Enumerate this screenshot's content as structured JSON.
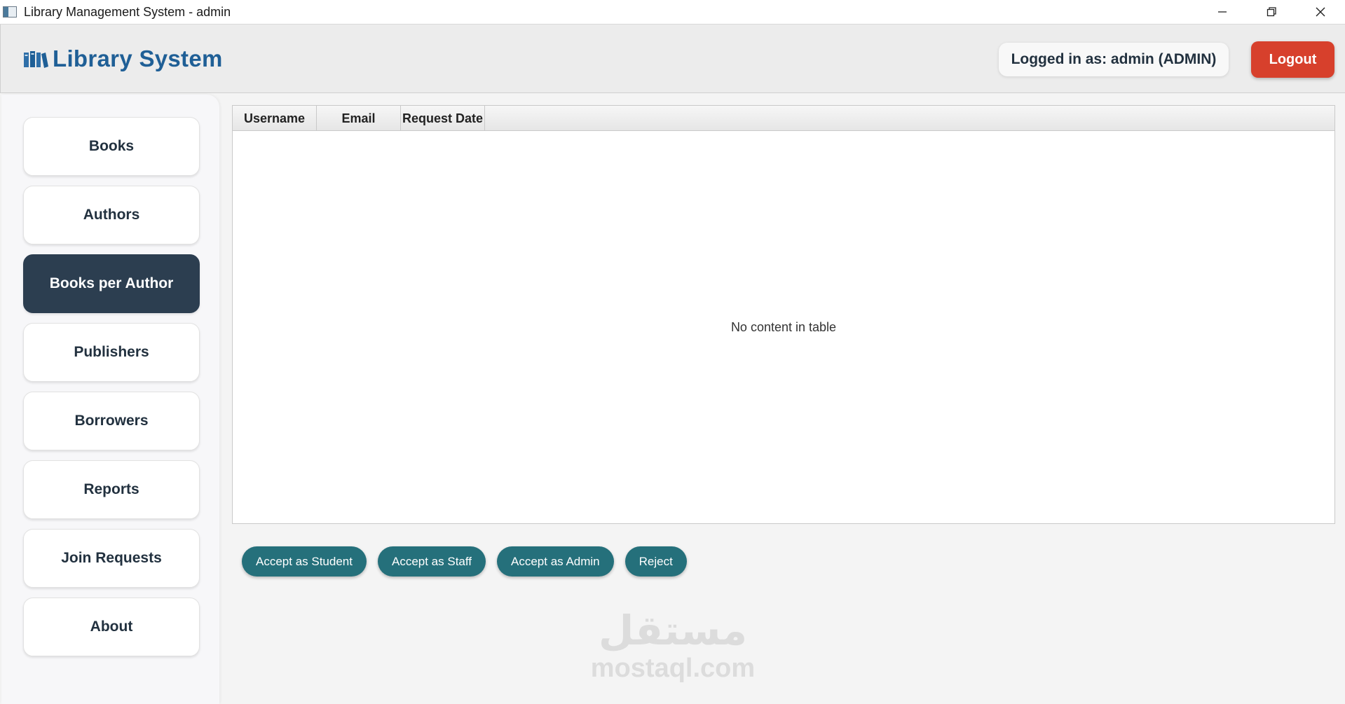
{
  "window": {
    "title": "Library Management System - admin",
    "controls": [
      "minimize-icon",
      "restore-icon",
      "close-icon"
    ]
  },
  "header": {
    "brand_icon": "books-icon",
    "brand_title": "Library System",
    "user_badge": "Logged in as: admin (ADMIN)",
    "logout_label": "Logout"
  },
  "sidebar": {
    "items": [
      {
        "label": "Books",
        "active": false
      },
      {
        "label": "Authors",
        "active": false
      },
      {
        "label": "Books per Author",
        "active": true
      },
      {
        "label": "Publishers",
        "active": false
      },
      {
        "label": "Borrowers",
        "active": false
      },
      {
        "label": "Reports",
        "active": false
      },
      {
        "label": "Join Requests",
        "active": false
      },
      {
        "label": "About",
        "active": false
      }
    ]
  },
  "table": {
    "columns": [
      "Username",
      "Email",
      "Request Date"
    ],
    "rows": [],
    "empty_message": "No content in table"
  },
  "actions": {
    "accept_student": "Accept as Student",
    "accept_staff": "Accept as Staff",
    "accept_admin": "Accept as Admin",
    "reject": "Reject"
  },
  "watermark": {
    "arabic": "مستقل",
    "latin": "mostaql.com"
  },
  "colors": {
    "brand": "#1f5f96",
    "logout": "#d7402c",
    "active_nav": "#2c3e50",
    "action_button": "#25707b"
  }
}
